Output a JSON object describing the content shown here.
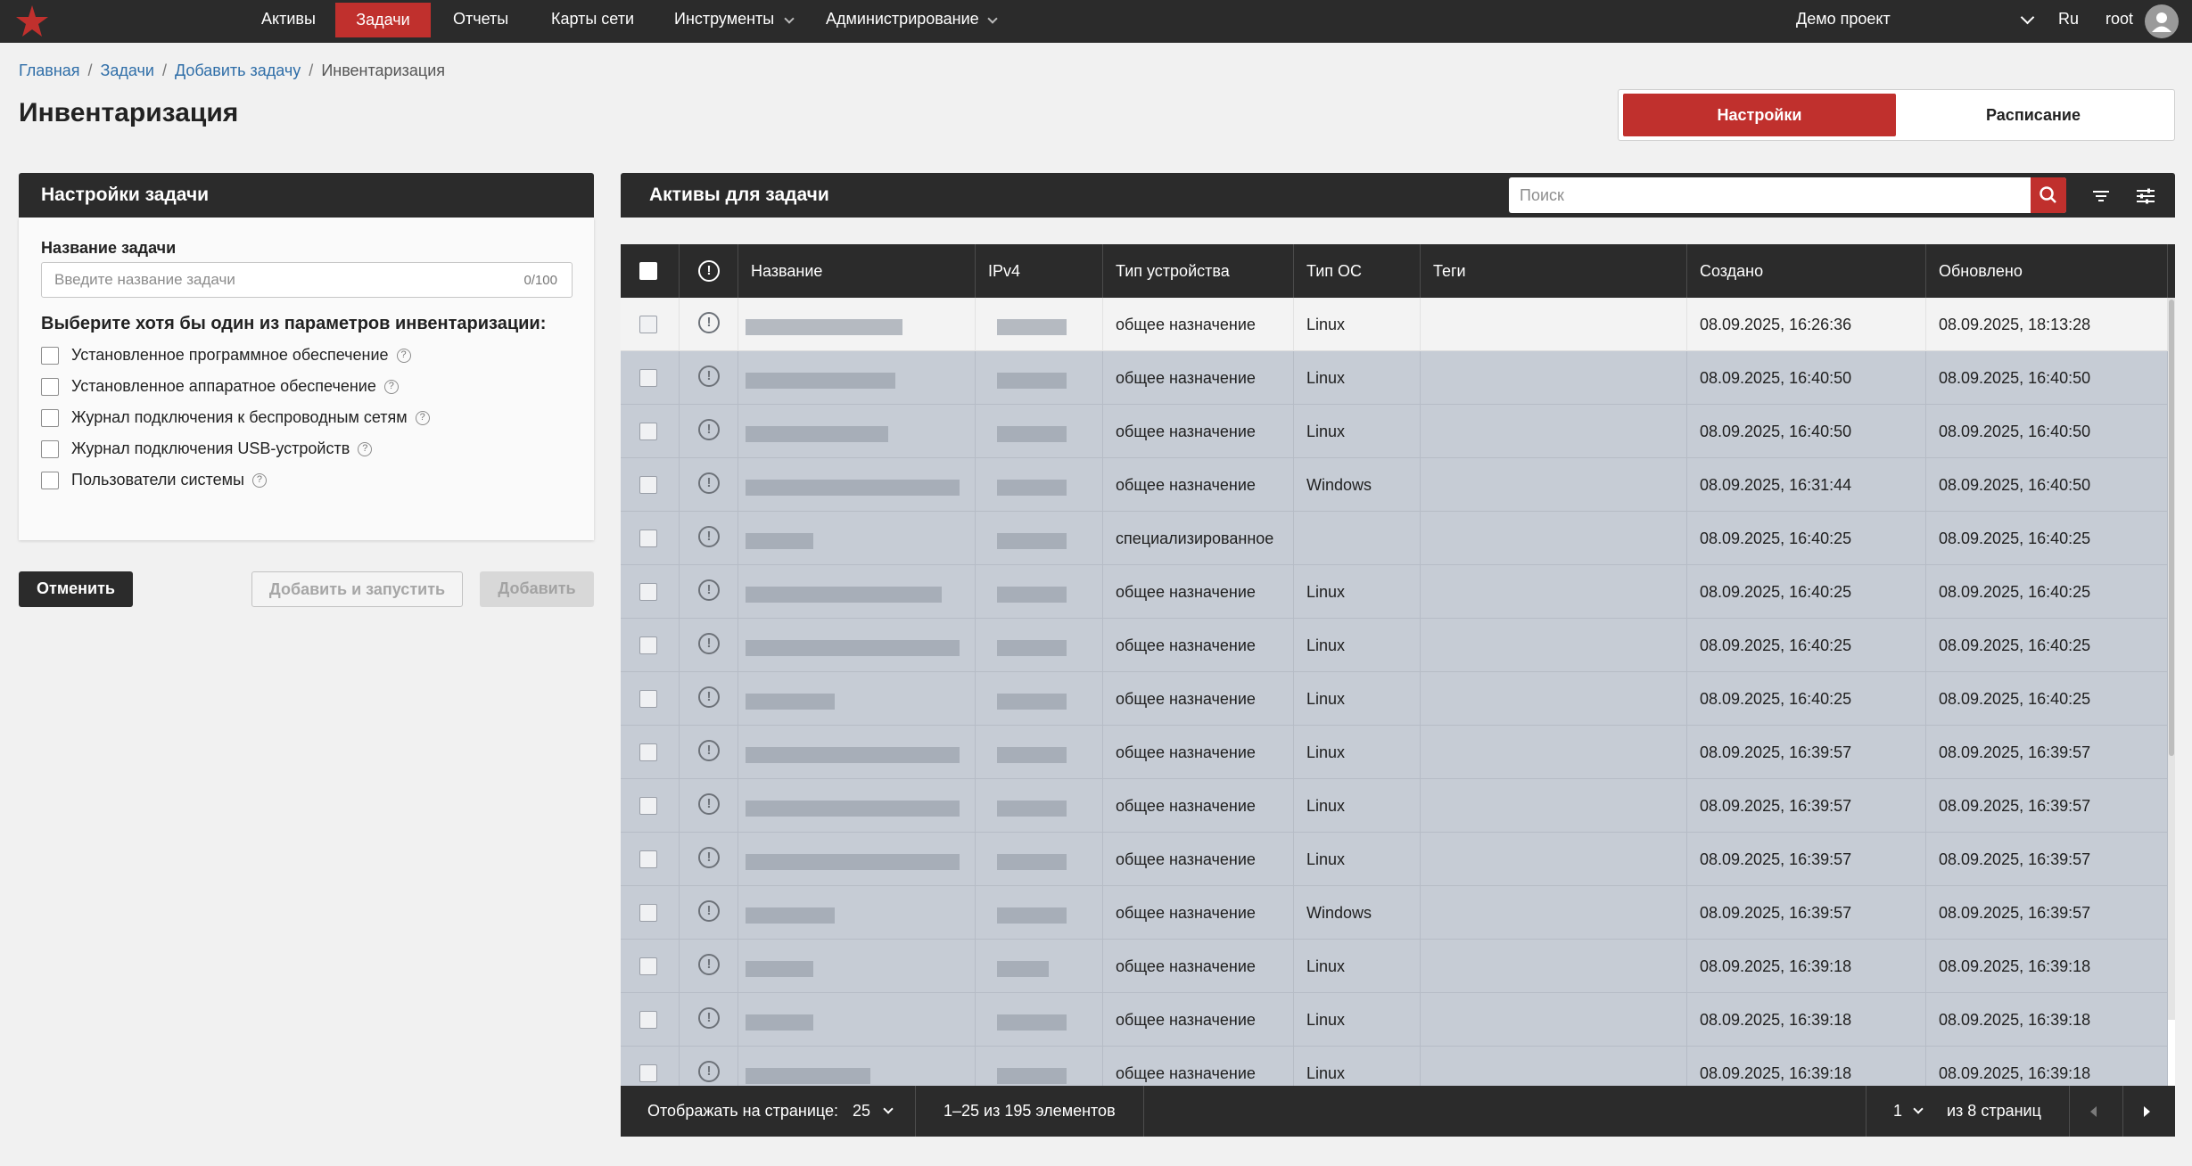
{
  "nav": {
    "items": [
      {
        "label": "Активы"
      },
      {
        "label": "Задачи"
      },
      {
        "label": "Отчеты"
      },
      {
        "label": "Карты сети"
      },
      {
        "label": "Инструменты"
      },
      {
        "label": "Администрирование"
      }
    ],
    "project": "Демо проект",
    "language": "Ru",
    "user": "root"
  },
  "breadcrumb": [
    "Главная",
    "Задачи",
    "Добавить задачу",
    "Инвентаризация"
  ],
  "page_title": "Инвентаризация",
  "tabs": {
    "settings": "Настройки",
    "schedule": "Расписание"
  },
  "settings_panel": {
    "title": "Настройки задачи",
    "name_label": "Название задачи",
    "name_placeholder": "Введите название задачи",
    "name_counter": "0/100",
    "params_label": "Выберите хотя бы один из параметров инвентаризации:",
    "options": [
      "Установленное программное обеспечение",
      "Установленное аппаратное обеспечение",
      "Журнал подключения к беспроводным сетям",
      "Журнал подключения USB-устройств",
      "Пользователи системы"
    ]
  },
  "buttons": {
    "cancel": "Отменить",
    "add_run": "Добавить и запустить",
    "add": "Добавить"
  },
  "assets_panel": {
    "title": "Активы для задачи",
    "search_placeholder": "Поиск",
    "columns": {
      "name": "Название",
      "ipv4": "IPv4",
      "device_type": "Тип устройства",
      "os_type": "Тип ОС",
      "tags": "Теги",
      "created": "Создано",
      "updated": "Обновлено"
    },
    "rows": [
      {
        "device_type": "общее назначение",
        "os": "Linux",
        "created": "08.09.2025, 16:26:36",
        "updated": "08.09.2025, 18:13:28"
      },
      {
        "device_type": "общее назначение",
        "os": "Linux",
        "created": "08.09.2025, 16:40:50",
        "updated": "08.09.2025, 16:40:50"
      },
      {
        "device_type": "общее назначение",
        "os": "Linux",
        "created": "08.09.2025, 16:40:50",
        "updated": "08.09.2025, 16:40:50"
      },
      {
        "device_type": "общее назначение",
        "os": "Windows",
        "created": "08.09.2025, 16:31:44",
        "updated": "08.09.2025, 16:40:50"
      },
      {
        "device_type": "специализированное",
        "os": "",
        "created": "08.09.2025, 16:40:25",
        "updated": "08.09.2025, 16:40:25"
      },
      {
        "device_type": "общее назначение",
        "os": "Linux",
        "created": "08.09.2025, 16:40:25",
        "updated": "08.09.2025, 16:40:25"
      },
      {
        "device_type": "общее назначение",
        "os": "Linux",
        "created": "08.09.2025, 16:40:25",
        "updated": "08.09.2025, 16:40:25"
      },
      {
        "device_type": "общее назначение",
        "os": "Linux",
        "created": "08.09.2025, 16:40:25",
        "updated": "08.09.2025, 16:40:25"
      },
      {
        "device_type": "общее назначение",
        "os": "Linux",
        "created": "08.09.2025, 16:39:57",
        "updated": "08.09.2025, 16:39:57"
      },
      {
        "device_type": "общее назначение",
        "os": "Linux",
        "created": "08.09.2025, 16:39:57",
        "updated": "08.09.2025, 16:39:57"
      },
      {
        "device_type": "общее назначение",
        "os": "Linux",
        "created": "08.09.2025, 16:39:57",
        "updated": "08.09.2025, 16:39:57"
      },
      {
        "device_type": "общее назначение",
        "os": "Windows",
        "created": "08.09.2025, 16:39:57",
        "updated": "08.09.2025, 16:39:57"
      },
      {
        "device_type": "общее назначение",
        "os": "Linux",
        "created": "08.09.2025, 16:39:18",
        "updated": "08.09.2025, 16:39:18"
      },
      {
        "device_type": "общее назначение",
        "os": "Linux",
        "created": "08.09.2025, 16:39:18",
        "updated": "08.09.2025, 16:39:18"
      },
      {
        "device_type": "общее назначение",
        "os": "Linux",
        "created": "08.09.2025, 16:39:18",
        "updated": "08.09.2025, 16:39:18"
      }
    ]
  },
  "pagination": {
    "per_page_label": "Отображать на странице:",
    "per_page": "25",
    "range": "1–25 из 195 элементов",
    "page": "1",
    "total_pages": "из 8 страниц"
  },
  "colors": {
    "accent": "#c0302d",
    "dark": "#2b2b2b",
    "row_selected": "#c6ccd5"
  },
  "icons": [
    "star-logo-icon",
    "chevron-down-icon",
    "user-avatar-icon",
    "help-icon",
    "search-icon",
    "filter-icon",
    "settings-sliders-icon",
    "alert-circle-icon",
    "arrow-left-icon",
    "arrow-right-icon"
  ]
}
